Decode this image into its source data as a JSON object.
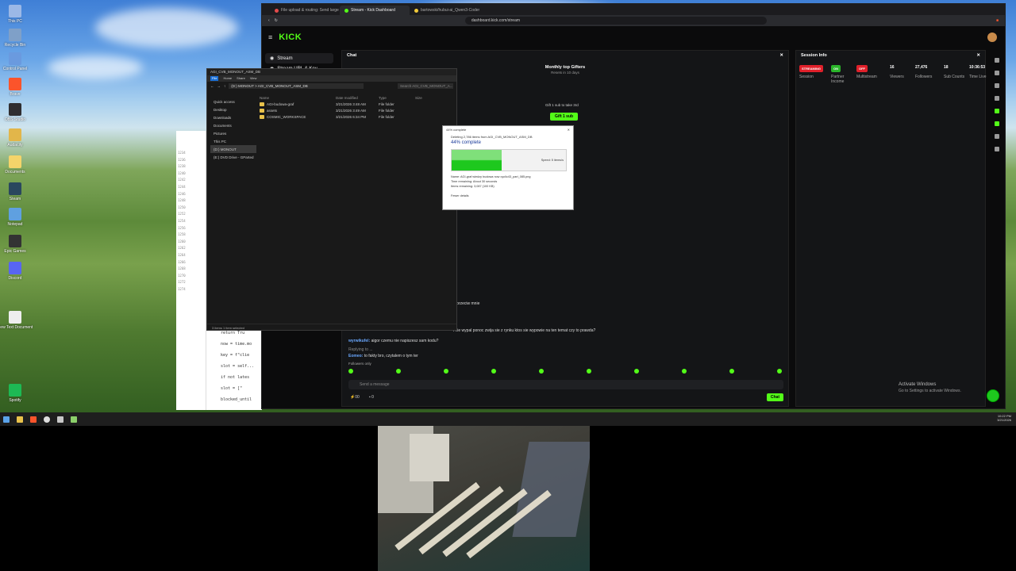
{
  "desktop": {
    "icons": [
      {
        "label": "This PC",
        "color": "#9bb8e6"
      },
      {
        "label": "Recycle Bin",
        "color": "#7fa0c8"
      },
      {
        "label": "Control Panel",
        "color": "#6a9adf"
      },
      {
        "label": "Brave",
        "color": "#fb542b"
      },
      {
        "label": "OBS Studio",
        "color": "#302e31"
      },
      {
        "label": "Audacity",
        "color": "#e2b64a"
      },
      {
        "label": "Documents",
        "color": "#f4d46a"
      },
      {
        "label": "Steam",
        "color": "#2a475e"
      },
      {
        "label": "Notepad",
        "color": "#5fa0e0"
      },
      {
        "label": "Epic Games",
        "color": "#333"
      },
      {
        "label": "Discord",
        "color": "#5865f2"
      },
      {
        "label": "New Text Document",
        "color": "#eeeeee"
      },
      {
        "label": "Spotify",
        "color": "#1db954"
      }
    ]
  },
  "browser": {
    "tabs": [
      {
        "label": "File upload & routing: Send large ph",
        "color": "#e34b4b",
        "active": false
      },
      {
        "label": "Stream - Kick Dashboard",
        "color": "#53fc18",
        "active": true
      },
      {
        "label": "bartowski/hubui-ai_Qwen3-Coder-N",
        "color": "#f0c93a",
        "active": false
      }
    ],
    "url": "dashboard.kick.com/stream"
  },
  "kick": {
    "logo": "KICK",
    "sidebar": [
      {
        "label": "Stream",
        "selected": true
      },
      {
        "label": "Stream URL & Key",
        "selected": false
      }
    ],
    "chat": {
      "title": "Chat",
      "gifters_title": "Monthly top Gifters",
      "gifters_sub": "Resets in 10 days",
      "gift_note": "Gift 1 sub to take 3rd",
      "gift_button": "Gift 1 sub",
      "lines": [
        {
          "user": "",
          "text": "o przeciw mnie"
        },
        {
          "user": "",
          "text": "i nie wypal ponoc zwija sie z rynku ktos sie wypowie na ten temat czy to prawda?"
        },
        {
          "user": "wyrwikufel:",
          "text": "aigor czemu nie napiszesz sam kodu?"
        },
        {
          "user": "",
          "text": "Replying to ..."
        },
        {
          "user": "Eomeo:",
          "text": "to fakty bro, czytalem o tym ter"
        }
      ],
      "followers_only": "Followers only",
      "placeholder": "Send a message",
      "chat_button": "Chat",
      "counter_a": "00",
      "counter_b": "0"
    },
    "session": {
      "title": "Session Info",
      "stats": [
        {
          "value": "STREAMING",
          "label": "Session",
          "badge_color": "#e0202a"
        },
        {
          "value": "ON",
          "label": "Partner Income",
          "badge_color": "#2ab52a"
        },
        {
          "value": "OFF",
          "label": "Multistream",
          "badge_color": "#e0202a"
        },
        {
          "value": "16",
          "label": "Viewers"
        },
        {
          "value": "27,476",
          "label": "Followers"
        },
        {
          "value": "18",
          "label": "Sub Counts"
        },
        {
          "value": "10:36:53",
          "label": "Time Live"
        }
      ]
    }
  },
  "explorer": {
    "title": "AGI_CVB_MONOUT_ASM_DB",
    "ribbon": [
      "File",
      "Home",
      "Share",
      "View"
    ],
    "path": "(D:) MONOUT > AGI_CVB_MONOUT_ASM_DB",
    "search": "Search AGI_CVB_MONOUT_A...",
    "nav": [
      "Quick access",
      "Desktop",
      "Downloads",
      "Documents",
      "Pictures",
      "This PC",
      "(D:) MONOUT",
      "(E:) DVD Drive - GParted"
    ],
    "columns": [
      "Name",
      "Date modified",
      "Type",
      "Size"
    ],
    "files": [
      {
        "name": "AGI-budowa-graf",
        "date": "3/21/2026 3:48 AM",
        "type": "File folder",
        "size": ""
      },
      {
        "name": "assets",
        "date": "3/21/2026 3:49 AM",
        "type": "File folder",
        "size": ""
      },
      {
        "name": "COSMIC_WORKSPACE",
        "date": "3/21/2026 6:34 PM",
        "type": "File folder",
        "size": ""
      }
    ],
    "status": "3 items   1 item selected"
  },
  "dialog": {
    "title": "44% complete",
    "line1": "Deleting 2,786 items from AGI_CVB_MONOUT_ASM_DB",
    "percent_text": "44% complete",
    "progress": 0.44,
    "speed": "Speed: 5 items/s",
    "name": "Name: AGI-graf wiedzy budowa now cyclic43_part_085.png",
    "time_remaining": "Time remaining: About 30 seconds",
    "items_remaining": "Items remaining: 3,087 (100 KB)",
    "more": "Fewer details"
  },
  "editor": {
    "lines": [
      "return Tru",
      "now = time.mo",
      "key = f\"clie",
      "slot = self...",
      "if not lates",
      "slot = [\"",
      "blocked_until"
    ],
    "line_numbers": [
      "1234",
      "1236",
      "1238",
      "1240",
      "1242",
      "1244",
      "1246",
      "1248",
      "1250",
      "1252",
      "1254",
      "1256",
      "1258",
      "1260",
      "1262",
      "1264",
      "1266",
      "1268",
      "1270",
      "1272",
      "1274"
    ]
  },
  "watermark": {
    "title": "Activate Windows",
    "sub": "Go to Settings to activate Windows."
  },
  "tray": {
    "time": "10:22 PM",
    "date": "3/21/2026"
  },
  "taskbar": [
    "start-icon",
    "file-explorer-icon",
    "brave-icon",
    "obs-icon",
    "explorer-icon",
    "notepad-icon"
  ]
}
